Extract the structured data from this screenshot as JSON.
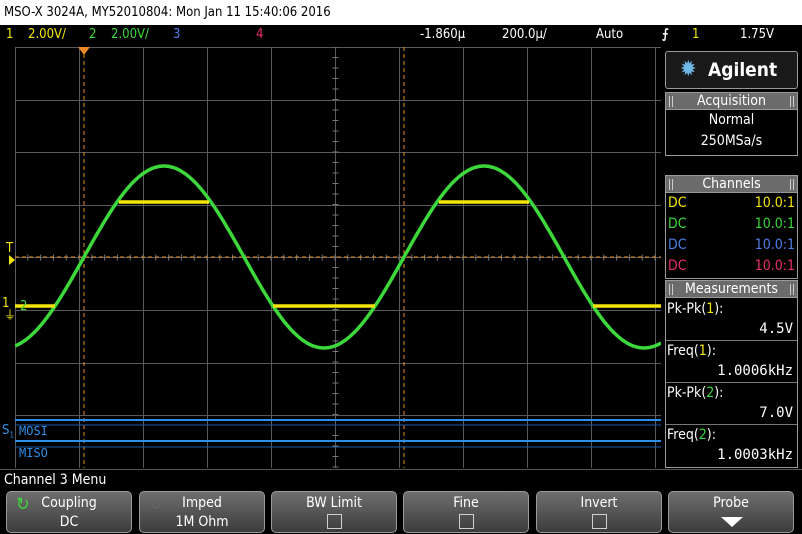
{
  "title_bar": {
    "text": "MSO-X 3024A, MY52010804: Mon Jan 11 15:40:06 2016"
  },
  "status": {
    "ch1": {
      "num": "1",
      "scale": "2.00V/",
      "color": "#f4e60a"
    },
    "ch2": {
      "num": "2",
      "scale": "2.00V/",
      "color": "#3cd83c"
    },
    "ch3": {
      "num": "3",
      "color": "#4f7de8"
    },
    "ch4": {
      "num": "4",
      "color": "#e8306a"
    },
    "time_offset": "-1.860µ",
    "time_scale": "200.0µ/",
    "trigger_mode": "Auto",
    "trigger_icon": "trigger-edge-icon",
    "trigger_source": "1",
    "trigger_level": "1.75V"
  },
  "side_panel": {
    "logo": {
      "brand": "Agilent",
      "icon": "agilent-spark-icon"
    },
    "acquisition": {
      "header": "Acquisition",
      "mode": "Normal",
      "rate": "250MSa/s"
    },
    "channels": {
      "header": "Channels",
      "rows": [
        {
          "coupling": "DC",
          "probe": "10.0:1",
          "color": "#f4e60a"
        },
        {
          "coupling": "DC",
          "probe": "10.0:1",
          "color": "#3cd83c"
        },
        {
          "coupling": "DC",
          "probe": "10.0:1",
          "color": "#4f7de8"
        },
        {
          "coupling": "DC",
          "probe": "10.0:1",
          "color": "#e8306a"
        }
      ]
    },
    "measurements": {
      "header": "Measurements",
      "items": [
        {
          "name": "Pk-Pk(",
          "ch": "1",
          "close": "):",
          "value": "4.5V",
          "color": "#f4e60a"
        },
        {
          "name": "Freq(",
          "ch": "1",
          "close": "):",
          "value": "1.0006kHz",
          "color": "#f4e60a"
        },
        {
          "name": "Pk-Pk(",
          "ch": "2",
          "close": "):",
          "value": "7.0V",
          "color": "#3cd83c"
        },
        {
          "name": "Freq(",
          "ch": "2",
          "close": "):",
          "value": "1.0003kHz",
          "color": "#3cd83c"
        }
      ]
    }
  },
  "display": {
    "trigger_marker": "T",
    "ground_marker_1": "1",
    "ground_marker_2": "2",
    "serial_bus_label": "S",
    "serial_bus_sub": "1",
    "mosi_label": "MOSI",
    "miso_label": "MISO",
    "trace_colors": {
      "ch1": "#f4e60a",
      "ch2": "#3cd83c",
      "bus": "#2f8fe8",
      "cursor": "#e88a2a"
    }
  },
  "menu": {
    "title": "Channel 3 Menu"
  },
  "softkeys": [
    {
      "id": "coupling",
      "title": "Coupling",
      "value": "DC"
    },
    {
      "id": "imped",
      "title": "Imped",
      "value": "1M Ohm"
    },
    {
      "id": "bw-limit",
      "title": "BW Limit"
    },
    {
      "id": "fine",
      "title": "Fine"
    },
    {
      "id": "invert",
      "title": "Invert"
    },
    {
      "id": "probe",
      "title": "Probe"
    }
  ]
}
